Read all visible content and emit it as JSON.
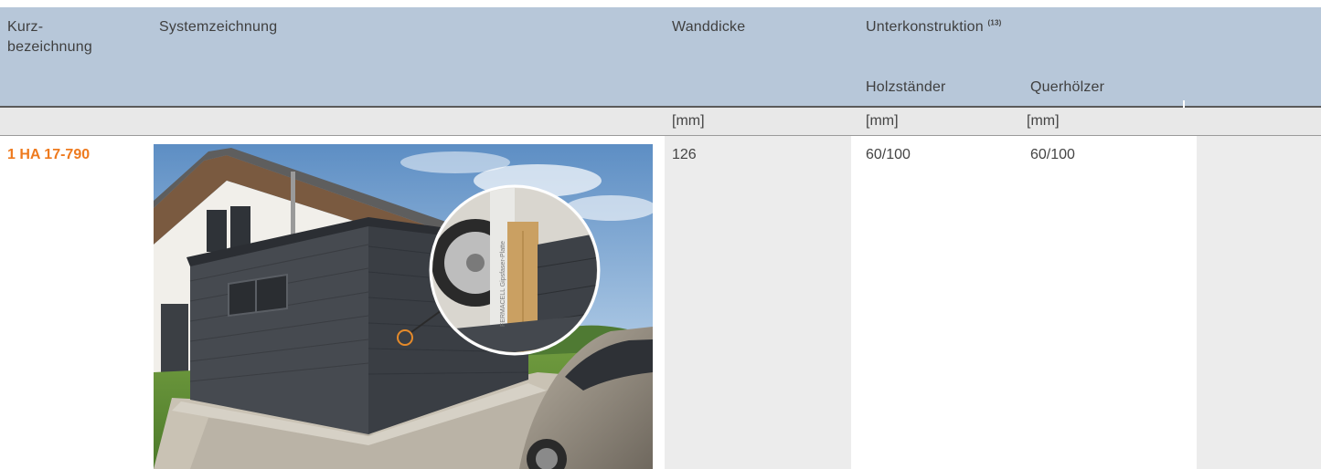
{
  "table": {
    "headers": {
      "kurz_line1": "Kurz-",
      "kurz_line2": "bezeichnung",
      "systemzeichnung": "Systemzeichnung",
      "wanddicke": "Wanddicke",
      "unterkonstruktion": "Unterkonstruktion",
      "unterkonstruktion_sup": "(13)",
      "holzstaender": "Holzständer",
      "querhoelzer": "Querhölzer"
    },
    "units": {
      "wanddicke": "[mm]",
      "holzstaender": "[mm]",
      "querhoelzer": "[mm]"
    },
    "rows": [
      {
        "kurzbezeichnung": "1 HA 17-790",
        "wanddicke": "126",
        "holzstaender": "60/100",
        "querhoelzer": "60/100"
      }
    ]
  },
  "image": {
    "plate_text": "FERMACELL Gipsfaser-Platte"
  },
  "colors": {
    "header_bg": "#b7c7d9",
    "accent_orange": "#ee7a1e",
    "shade": "#ececec"
  }
}
